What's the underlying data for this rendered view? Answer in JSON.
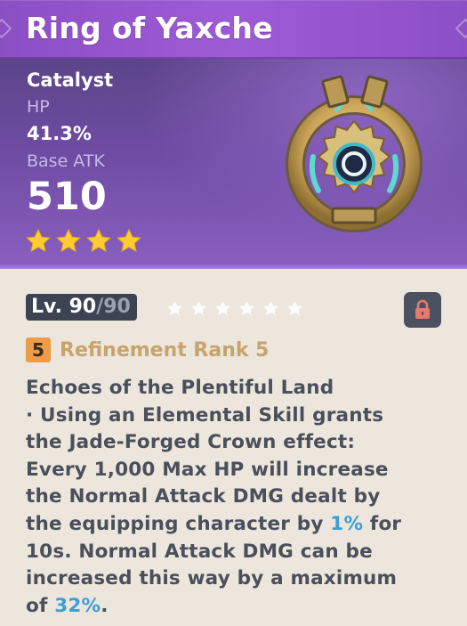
{
  "weapon": {
    "name": "Ring of Yaxche",
    "type": "Catalyst",
    "secondary_stat_label": "HP",
    "secondary_stat_value": "41.3%",
    "base_atk_label": "Base ATK",
    "base_atk_value": "510",
    "rarity_stars": 4,
    "level_current": "Lv. 90",
    "level_max": "/90",
    "ascension_stars": 6,
    "locked": true,
    "refinement_rank": "5",
    "refinement_text": "Refinement Rank 5"
  },
  "passive": {
    "line1": "Echoes of the Plentiful Land",
    "line2": " · Using an Elemental Skill grants",
    "line3": "the Jade-Forged Crown effect:",
    "line4": "Every 1,000 Max HP will increase",
    "line5": "the Normal Attack DMG dealt by",
    "line6_a": "the equipping character by ",
    "line6_hl": "1%",
    "line6_b": " for",
    "line7": "10s. Normal Attack DMG can be",
    "line8": "increased this way by a maximum",
    "line9_a": "of ",
    "line9_hl": "32%",
    "line9_b": "."
  },
  "colors": {
    "title_bar": "#9e5bd6",
    "star_gold": "#ffcc32",
    "highlight_blue": "#3c9ed6",
    "refine_badge": "#ee9c47",
    "body_text": "#4a4f5c"
  },
  "icons": {
    "rarity": "star-icon",
    "lock": "lock-icon",
    "weapon": "ring-catalyst-icon"
  }
}
